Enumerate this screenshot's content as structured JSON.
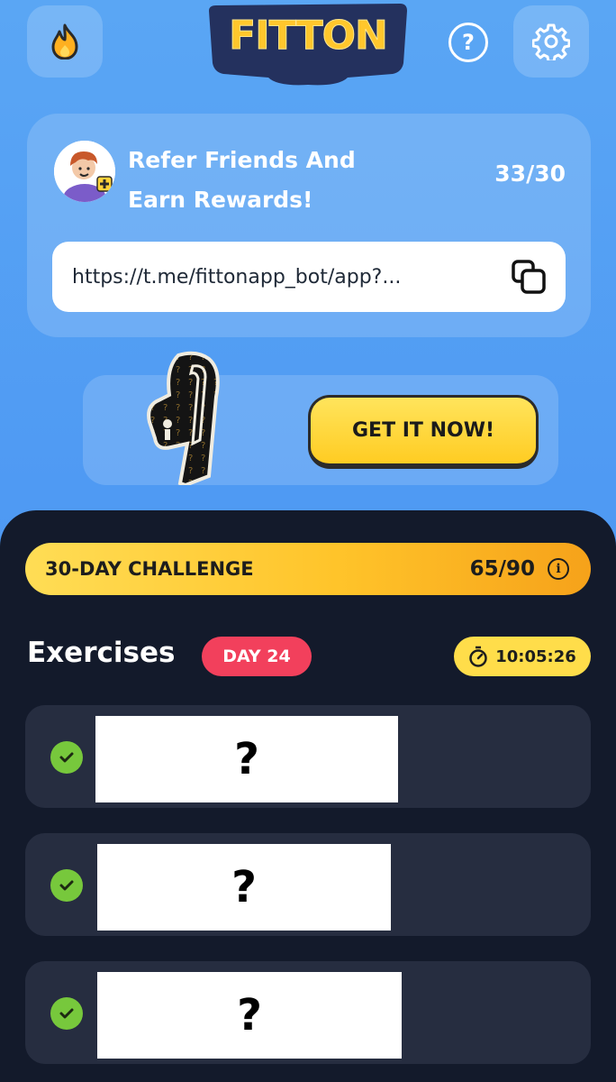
{
  "header": {
    "logo_text": "FITTON",
    "help_icon_text": "?"
  },
  "refer": {
    "title": "Refer Friends And Earn Rewards!",
    "count": "33/30",
    "link": "https://t.me/fittonapp_bot/app?..."
  },
  "promo": {
    "button_label": "GET IT NOW!"
  },
  "challenge": {
    "label": "30-DAY CHALLENGE",
    "count": "65/90",
    "progress": 0.722
  },
  "exercises": {
    "title": "Exercises",
    "day_badge": "DAY 24",
    "timer": "10:05:26",
    "items": [
      {
        "placeholder": "?",
        "completed": true
      },
      {
        "placeholder": "?",
        "completed": true
      },
      {
        "placeholder": "?",
        "completed": true
      }
    ]
  },
  "colors": {
    "background": "#4f9af3",
    "panel": "#131a2b",
    "accent_yellow": "#ffcc22",
    "day_badge": "#f2405c",
    "check_green": "#77c83c"
  }
}
